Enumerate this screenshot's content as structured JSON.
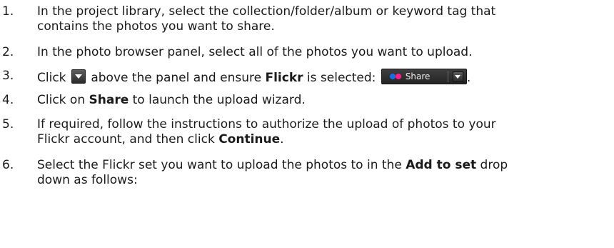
{
  "steps": [
    {
      "number": "1.",
      "line1": "In the project library, select the collection/folder/album or keyword tag that",
      "line2": "contains the photos you want to share."
    },
    {
      "number": "2.",
      "line1": "In the photo browser panel, select all of the photos you want to upload."
    },
    {
      "number": "3.",
      "prefix": "Click",
      "middle": "above the panel and ensure",
      "bold": "Flickr",
      "suffix": "is selected:",
      "end": ".",
      "share_label": "Share"
    },
    {
      "number": "4.",
      "prefix": "Click on",
      "bold": "Share",
      "suffix": "to launch the upload wizard."
    },
    {
      "number": "5.",
      "line1": "If required, follow the instructions to authorize the upload of photos to your",
      "line2_prefix": "Flickr account, and then click",
      "line2_bold": "Continue",
      "line2_suffix": "."
    },
    {
      "number": "6.",
      "line1_prefix": "Select the Flickr set you want to upload the photos to in the",
      "line1_bold": "Add to set",
      "line1_suffix": "drop",
      "line2": "down as follows:"
    }
  ],
  "colors": {
    "text": "#1a1a1a",
    "button_dark": "#2b2b2b",
    "flickr_blue": "#1c6ee8",
    "flickr_pink": "#ff1f8a"
  },
  "icons": {
    "dropdown": "chevron-down-icon",
    "flickr": "flickr-logo-icon"
  }
}
